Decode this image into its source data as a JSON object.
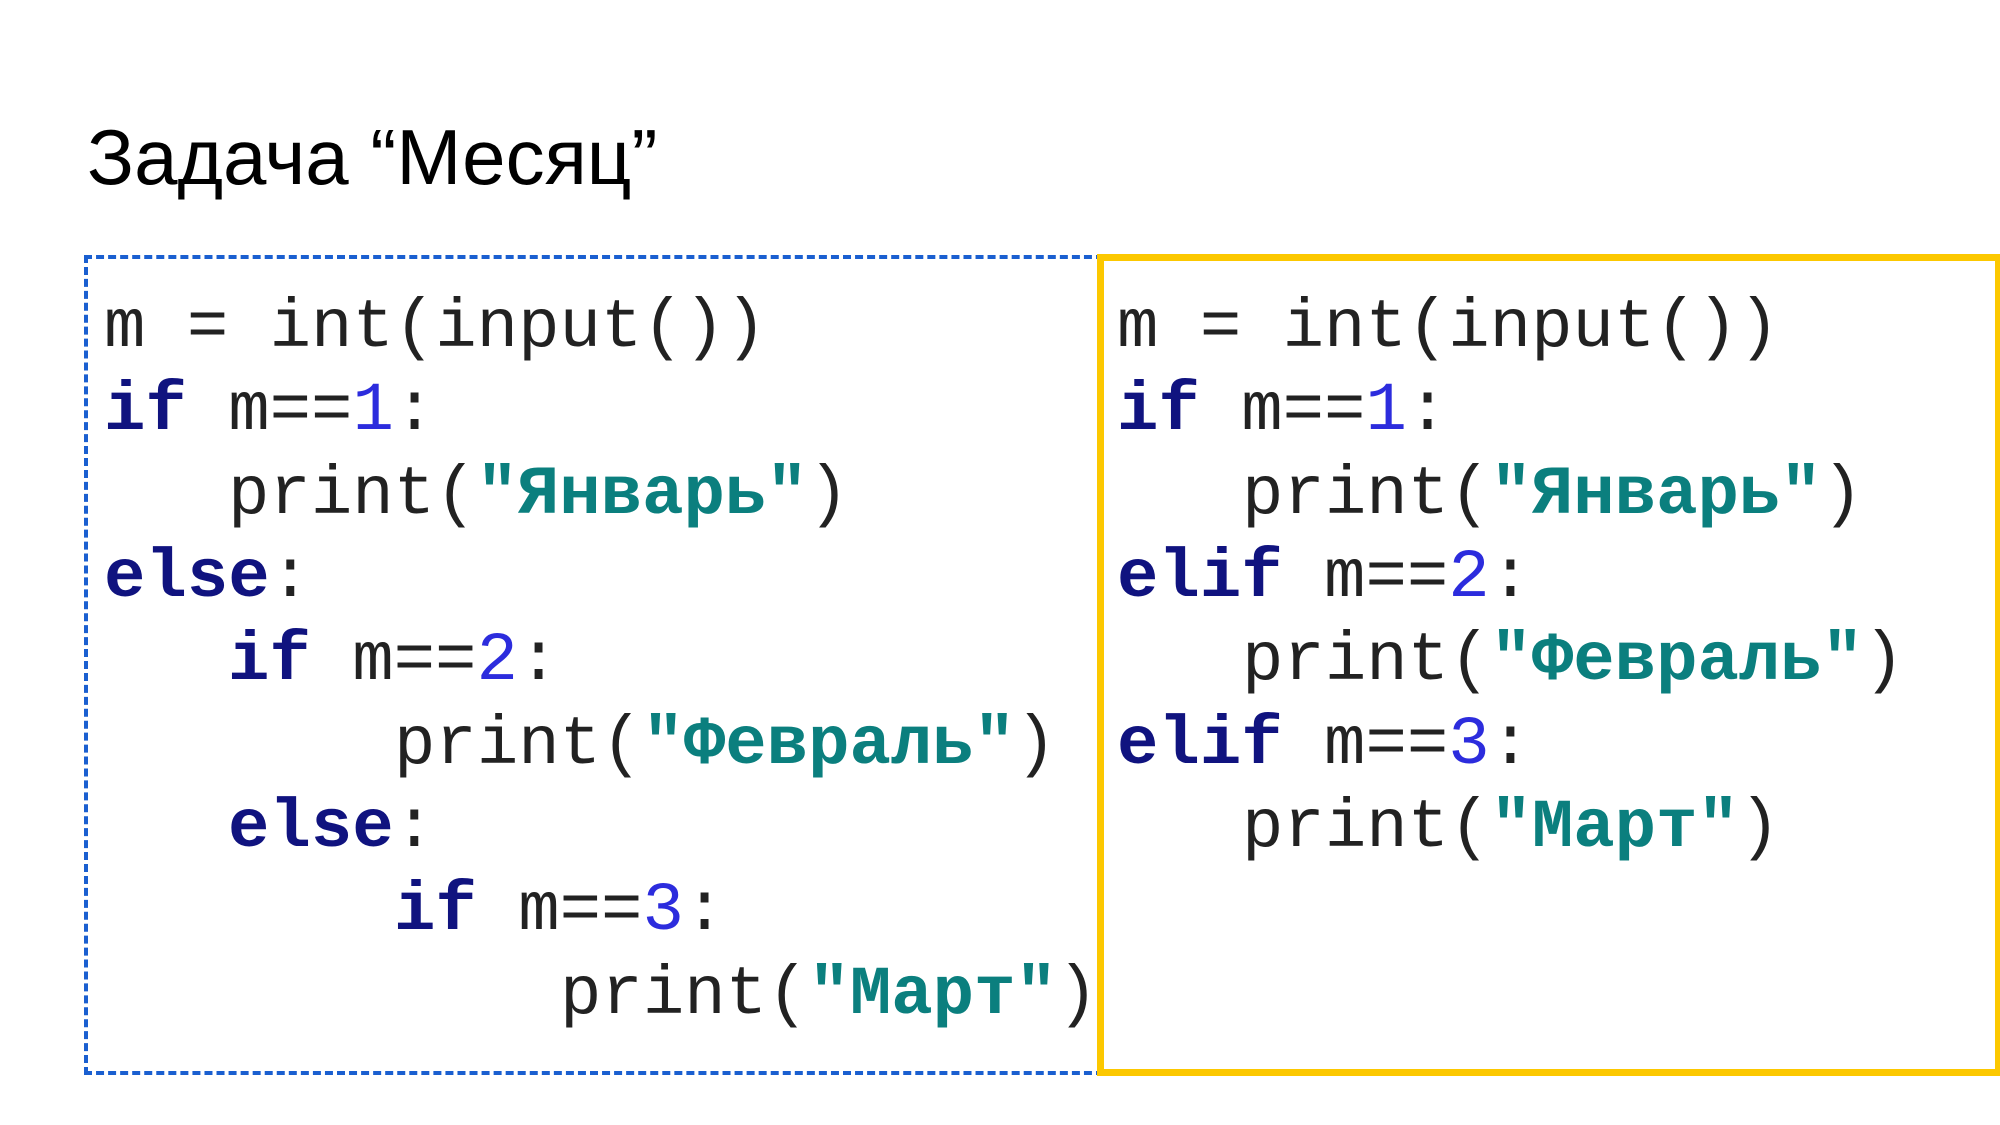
{
  "title": "Задача “Месяц”",
  "code_left": {
    "line1": {
      "prefix": "m = int(input())"
    },
    "line2": {
      "kw": "if",
      "cond": " m==",
      "num": "1",
      "colon": ":"
    },
    "line3": {
      "fn": "print(",
      "str": "\"Январь\"",
      "close": ")"
    },
    "line4": {
      "kw": "else",
      "colon": ":"
    },
    "line5": {
      "kw": "if",
      "cond": " m==",
      "num": "2",
      "colon": ":"
    },
    "line6": {
      "fn": "print(",
      "str": "\"Февраль\"",
      "close": ")"
    },
    "line7": {
      "kw": "else",
      "colon": ":"
    },
    "line8": {
      "kw": "if",
      "cond": " m==",
      "num": "3",
      "colon": ":"
    },
    "line9": {
      "fn": "print(",
      "str": "\"Март\"",
      "close": ")"
    }
  },
  "code_right": {
    "line1": {
      "prefix": "m = int(input())"
    },
    "line2": {
      "kw": "if",
      "cond": " m==",
      "num": "1",
      "colon": ":"
    },
    "line3": {
      "fn": "print(",
      "str": "\"Январь\"",
      "close": ")"
    },
    "line4": {
      "kw": "elif",
      "cond": " m==",
      "num": "2",
      "colon": ":"
    },
    "line5": {
      "fn": "print(",
      "str": "\"Февраль\"",
      "close": ")"
    },
    "line6": {
      "kw": "elif",
      "cond": " m==",
      "num": "3",
      "colon": ":"
    },
    "line7": {
      "fn": "print(",
      "str": "\"Март\"",
      "close": ")"
    }
  },
  "colors": {
    "keyword": "#10137f",
    "string": "#0b7f7e",
    "number": "#2c2cdd",
    "left_box_border": "#1a5fd0",
    "right_box_border": "#fcc800"
  }
}
